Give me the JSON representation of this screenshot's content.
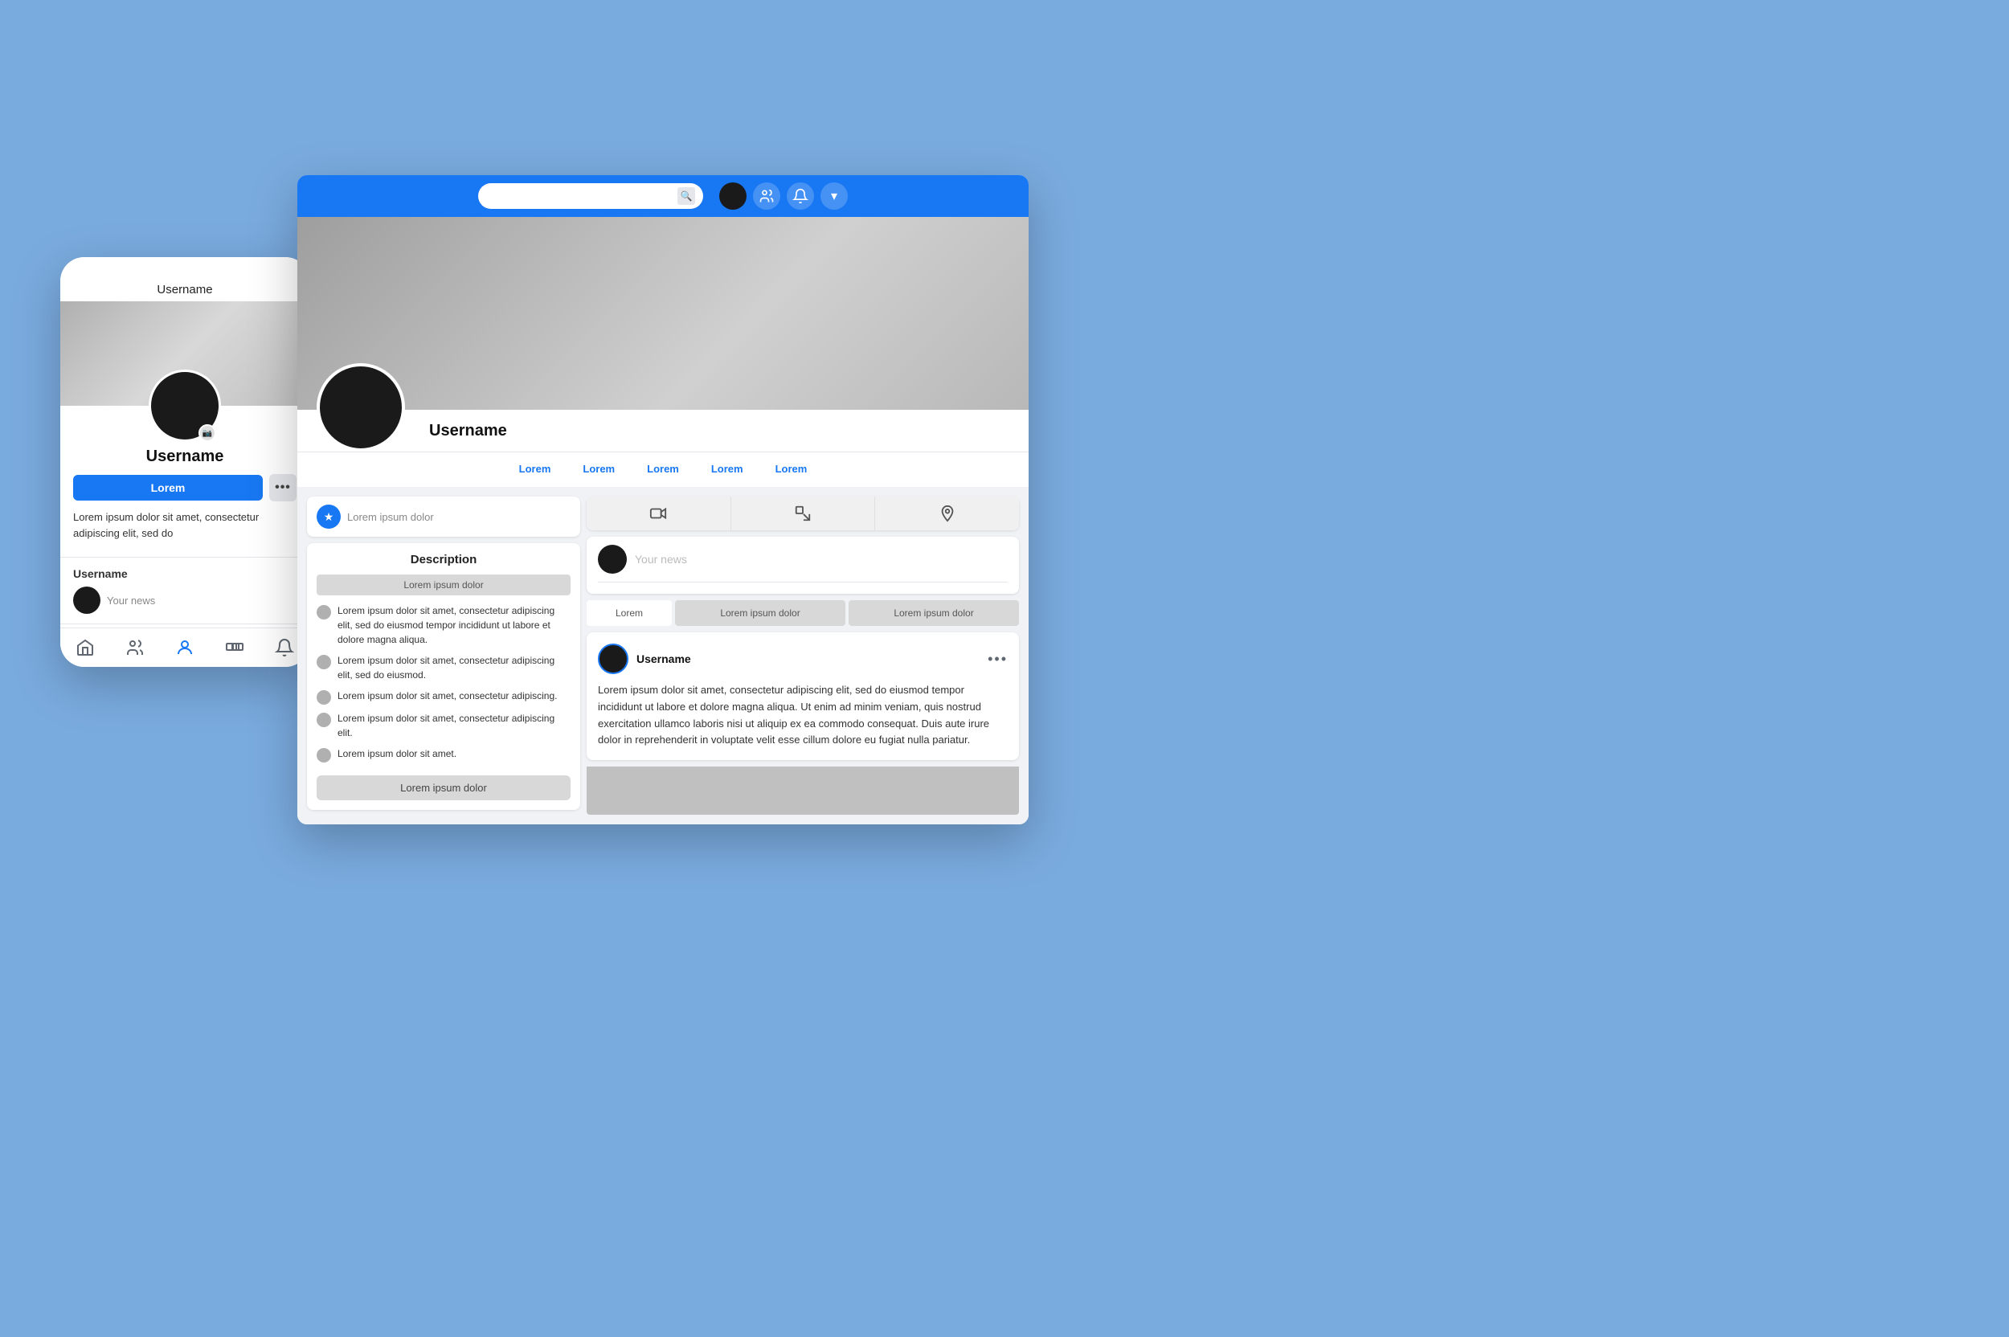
{
  "background_color": "#7aabdf",
  "phone": {
    "username_header": "Username",
    "profile_name": "Username",
    "action_button": "Lorem",
    "bio_text": "Lorem ipsum dolor sit amet, consectetur adipiscing elit, sed do",
    "news_label": "Username",
    "news_placeholder": "Your news",
    "action_dots": "•••",
    "bottom_nav": {
      "items": [
        "home",
        "friends",
        "profile-active",
        "groups",
        "notifications"
      ]
    }
  },
  "browser": {
    "search_placeholder": "",
    "nav_icons": [
      "friends-icon",
      "bell-icon",
      "chevron-down-icon"
    ],
    "profile_name": "Username",
    "tabs": [
      "Lorem",
      "Lorem",
      "Lorem",
      "Lorem",
      "Lorem"
    ],
    "status_placeholder": "Lorem ipsum dolor",
    "description_title": "Description",
    "description_label": "Lorem ipsum dolor",
    "description_items": [
      "Lorem ipsum dolor sit amet, consectetur adipiscing elit, sed do eiusmod tempor incididunt ut labore et dolore magna aliqua.",
      "Lorem ipsum dolor sit amet, consectetur adipiscing elit, sed do eiusmod.",
      "Lorem ipsum dolor sit amet, consectetur adipiscing.",
      "Lorem ipsum dolor sit amet, consectetur adipiscing elit.",
      "Lorem ipsum dolor sit amet."
    ],
    "description_btn": "Lorem ipsum dolor",
    "media_tabs": [
      "video-camera",
      "tag",
      "location-pin"
    ],
    "your_news_text": "Your news",
    "filter_tabs": [
      "Lorem",
      "Lorem ipsum dolor",
      "Lorem ipsum dolor"
    ],
    "post": {
      "username": "Username",
      "dots": "•••",
      "body": "Lorem ipsum dolor sit amet, consectetur adipiscing elit, sed do eiusmod tempor incididunt ut labore et dolore magna aliqua. Ut enim ad minim veniam, quis nostrud exercitation ullamco laboris nisi ut aliquip ex ea commodo consequat. Duis aute irure dolor in reprehenderit in voluptate velit esse cillum dolore eu fugiat nulla pariatur."
    }
  }
}
